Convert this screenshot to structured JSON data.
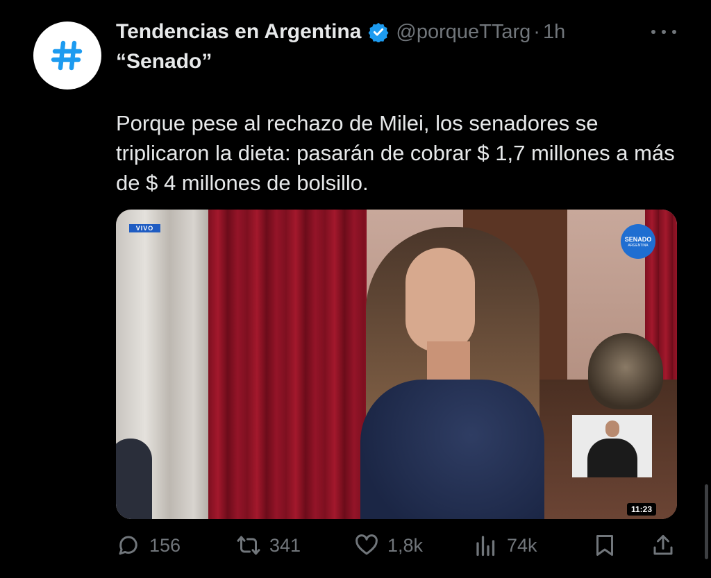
{
  "tweet": {
    "author_name": "Tendencias en Argentina",
    "handle": "@porqueTTarg",
    "separator": "·",
    "time": "1h",
    "subtitle": "“Senado”",
    "text": "Porque pese al rechazo de Milei, los senadores se triplicaron la dieta: pasarán de cobrar $ 1,7 millones a más de $ 4 millones de bolsillo."
  },
  "media": {
    "live_badge": "VIVO",
    "logo_text": "SENADO",
    "logo_sub": "ARGENTINA",
    "duration": "11:23"
  },
  "actions": {
    "replies": "156",
    "reposts": "341",
    "likes": "1,8k",
    "views": "74k"
  },
  "colors": {
    "background": "#000000",
    "text_primary": "#e7e9ea",
    "text_secondary": "#71767b",
    "verified_blue": "#1d9bf0",
    "avatar_hash": "#1d9bf0"
  }
}
